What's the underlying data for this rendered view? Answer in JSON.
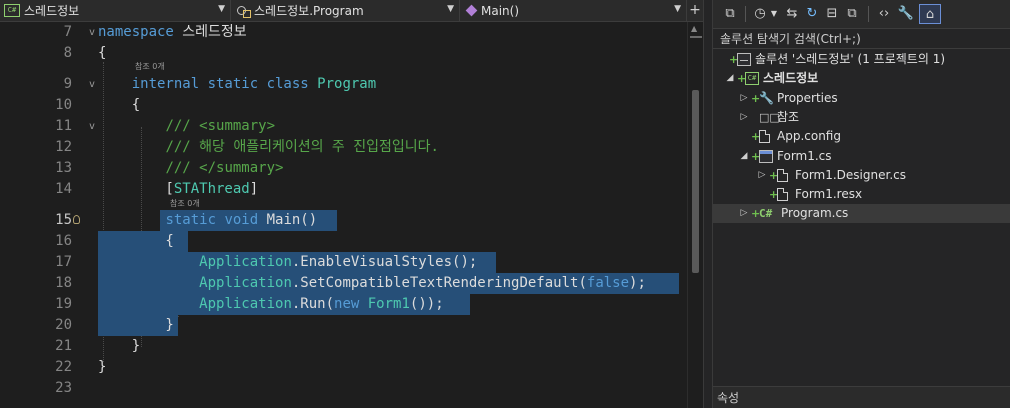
{
  "navbar": {
    "project": {
      "badge": "C#",
      "label": "스레드정보"
    },
    "class_member": {
      "label": "스레드정보.Program"
    },
    "method": {
      "label": "Main()"
    },
    "add_label": "+"
  },
  "code": {
    "ref_label": "참조 0개",
    "lines": [
      {
        "n": "7",
        "fold": "v",
        "segments": [
          {
            "c": "kw",
            "t": "namespace"
          },
          {
            "c": "tx",
            "t": " 스레드정보"
          }
        ]
      },
      {
        "n": "8",
        "segments": [
          {
            "c": "tx",
            "t": "{"
          }
        ]
      },
      {
        "n": "9",
        "fold": "v",
        "segments": [
          {
            "c": "tx",
            "t": "    "
          },
          {
            "c": "kw",
            "t": "internal static class "
          },
          {
            "c": "ty",
            "t": "Program"
          }
        ]
      },
      {
        "n": "10",
        "segments": [
          {
            "c": "tx",
            "t": "    {"
          }
        ]
      },
      {
        "n": "11",
        "fold": "v",
        "segments": [
          {
            "c": "tx",
            "t": "        "
          },
          {
            "c": "cm",
            "t": "/// <summary>"
          }
        ]
      },
      {
        "n": "12",
        "segments": [
          {
            "c": "tx",
            "t": "        "
          },
          {
            "c": "cm",
            "t": "/// 해당 애플리케이션의 주 진입점입니다."
          }
        ]
      },
      {
        "n": "13",
        "segments": [
          {
            "c": "tx",
            "t": "        "
          },
          {
            "c": "cm",
            "t": "/// </summary>"
          }
        ]
      },
      {
        "n": "14",
        "segments": [
          {
            "c": "tx",
            "t": "        ["
          },
          {
            "c": "ty",
            "t": "STAThread"
          },
          {
            "c": "tx",
            "t": "]"
          }
        ]
      },
      {
        "n": "15",
        "segments": [
          {
            "c": "kw",
            "t": "static void "
          },
          {
            "c": "tx",
            "t": "Main()"
          }
        ]
      },
      {
        "n": "16",
        "segments": [
          {
            "c": "tx",
            "t": "        {"
          }
        ]
      },
      {
        "n": "17",
        "segments": [
          {
            "c": "tx",
            "t": "            "
          },
          {
            "c": "ty",
            "t": "Application"
          },
          {
            "c": "tx",
            "t": ".EnableVisualStyles();"
          }
        ]
      },
      {
        "n": "18",
        "segments": [
          {
            "c": "tx",
            "t": "            "
          },
          {
            "c": "ty",
            "t": "Application"
          },
          {
            "c": "tx",
            "t": ".SetCompatibleTextRenderingDefault("
          },
          {
            "c": "kw",
            "t": "false"
          },
          {
            "c": "tx",
            "t": ");"
          }
        ]
      },
      {
        "n": "19",
        "segments": [
          {
            "c": "tx",
            "t": "            "
          },
          {
            "c": "ty",
            "t": "Application"
          },
          {
            "c": "tx",
            "t": ".Run("
          },
          {
            "c": "kw",
            "t": "new "
          },
          {
            "c": "ty",
            "t": "Form1"
          },
          {
            "c": "tx",
            "t": "());"
          }
        ]
      },
      {
        "n": "20",
        "segments": [
          {
            "c": "tx",
            "t": "        }"
          }
        ]
      },
      {
        "n": "21",
        "segments": [
          {
            "c": "tx",
            "t": "    }"
          }
        ]
      },
      {
        "n": "22",
        "segments": [
          {
            "c": "tx",
            "t": "}"
          }
        ]
      },
      {
        "n": "23",
        "segments": []
      }
    ]
  },
  "solution_explorer": {
    "search_label": "솔루션 탐색기 검색(Ctrl+;)",
    "tree": [
      {
        "label": "솔루션 '스레드정보' (1 프로젝트의 1)",
        "icon": "solution-icon",
        "level": 0,
        "expander": "",
        "plus": true
      },
      {
        "label": "스레드정보",
        "icon": "csharp-project-icon",
        "level": 1,
        "expander": "▲",
        "plus": true,
        "bold": true
      },
      {
        "label": "Properties",
        "icon": "wrench-icon",
        "level": 2,
        "expander": "▷",
        "plus": true
      },
      {
        "label": "참조",
        "icon": "references-icon",
        "level": 2,
        "expander": "▷",
        "plus": false
      },
      {
        "label": "App.config",
        "icon": "config-file-icon",
        "level": 2,
        "expander": "",
        "plus": true
      },
      {
        "label": "Form1.cs",
        "icon": "form-icon",
        "level": 2,
        "expander": "▲",
        "plus": true
      },
      {
        "label": "Form1.Designer.cs",
        "icon": "file-icon",
        "level": 3,
        "expander": "▷",
        "plus": true
      },
      {
        "label": "Form1.resx",
        "icon": "file-icon",
        "level": 3,
        "expander": "",
        "plus": true
      },
      {
        "label": "Program.cs",
        "icon": "csharp-file-icon",
        "level": 2,
        "expander": "▷",
        "plus": true,
        "selected": true
      }
    ]
  },
  "properties": {
    "title": "속성"
  },
  "colors": {
    "keyword": "#569cd6",
    "type": "#4ec9b0",
    "comment": "#57a64a",
    "selection": "#264f78"
  }
}
